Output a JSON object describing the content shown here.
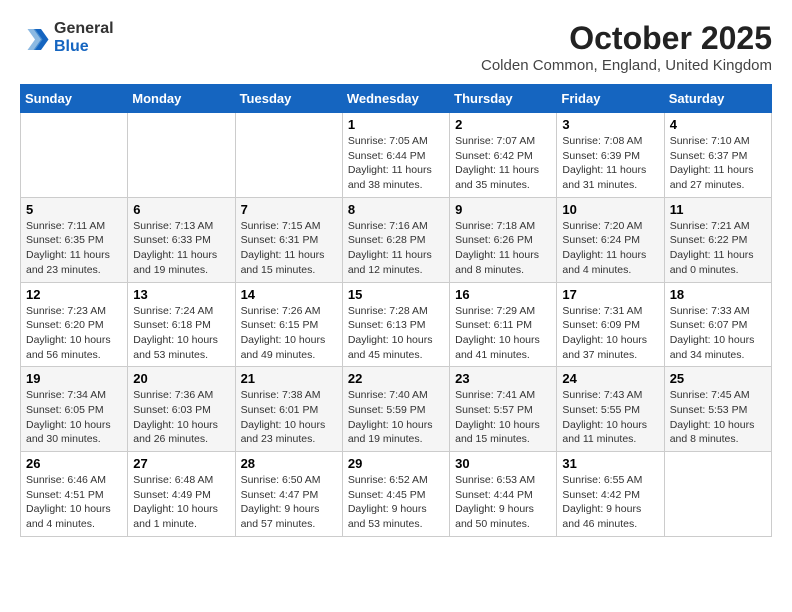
{
  "header": {
    "logo_general": "General",
    "logo_blue": "Blue",
    "month_title": "October 2025",
    "location": "Colden Common, England, United Kingdom"
  },
  "days_of_week": [
    "Sunday",
    "Monday",
    "Tuesday",
    "Wednesday",
    "Thursday",
    "Friday",
    "Saturday"
  ],
  "weeks": [
    [
      {
        "day": "",
        "detail": ""
      },
      {
        "day": "",
        "detail": ""
      },
      {
        "day": "",
        "detail": ""
      },
      {
        "day": "1",
        "detail": "Sunrise: 7:05 AM\nSunset: 6:44 PM\nDaylight: 11 hours\nand 38 minutes."
      },
      {
        "day": "2",
        "detail": "Sunrise: 7:07 AM\nSunset: 6:42 PM\nDaylight: 11 hours\nand 35 minutes."
      },
      {
        "day": "3",
        "detail": "Sunrise: 7:08 AM\nSunset: 6:39 PM\nDaylight: 11 hours\nand 31 minutes."
      },
      {
        "day": "4",
        "detail": "Sunrise: 7:10 AM\nSunset: 6:37 PM\nDaylight: 11 hours\nand 27 minutes."
      }
    ],
    [
      {
        "day": "5",
        "detail": "Sunrise: 7:11 AM\nSunset: 6:35 PM\nDaylight: 11 hours\nand 23 minutes."
      },
      {
        "day": "6",
        "detail": "Sunrise: 7:13 AM\nSunset: 6:33 PM\nDaylight: 11 hours\nand 19 minutes."
      },
      {
        "day": "7",
        "detail": "Sunrise: 7:15 AM\nSunset: 6:31 PM\nDaylight: 11 hours\nand 15 minutes."
      },
      {
        "day": "8",
        "detail": "Sunrise: 7:16 AM\nSunset: 6:28 PM\nDaylight: 11 hours\nand 12 minutes."
      },
      {
        "day": "9",
        "detail": "Sunrise: 7:18 AM\nSunset: 6:26 PM\nDaylight: 11 hours\nand 8 minutes."
      },
      {
        "day": "10",
        "detail": "Sunrise: 7:20 AM\nSunset: 6:24 PM\nDaylight: 11 hours\nand 4 minutes."
      },
      {
        "day": "11",
        "detail": "Sunrise: 7:21 AM\nSunset: 6:22 PM\nDaylight: 11 hours\nand 0 minutes."
      }
    ],
    [
      {
        "day": "12",
        "detail": "Sunrise: 7:23 AM\nSunset: 6:20 PM\nDaylight: 10 hours\nand 56 minutes."
      },
      {
        "day": "13",
        "detail": "Sunrise: 7:24 AM\nSunset: 6:18 PM\nDaylight: 10 hours\nand 53 minutes."
      },
      {
        "day": "14",
        "detail": "Sunrise: 7:26 AM\nSunset: 6:15 PM\nDaylight: 10 hours\nand 49 minutes."
      },
      {
        "day": "15",
        "detail": "Sunrise: 7:28 AM\nSunset: 6:13 PM\nDaylight: 10 hours\nand 45 minutes."
      },
      {
        "day": "16",
        "detail": "Sunrise: 7:29 AM\nSunset: 6:11 PM\nDaylight: 10 hours\nand 41 minutes."
      },
      {
        "day": "17",
        "detail": "Sunrise: 7:31 AM\nSunset: 6:09 PM\nDaylight: 10 hours\nand 37 minutes."
      },
      {
        "day": "18",
        "detail": "Sunrise: 7:33 AM\nSunset: 6:07 PM\nDaylight: 10 hours\nand 34 minutes."
      }
    ],
    [
      {
        "day": "19",
        "detail": "Sunrise: 7:34 AM\nSunset: 6:05 PM\nDaylight: 10 hours\nand 30 minutes."
      },
      {
        "day": "20",
        "detail": "Sunrise: 7:36 AM\nSunset: 6:03 PM\nDaylight: 10 hours\nand 26 minutes."
      },
      {
        "day": "21",
        "detail": "Sunrise: 7:38 AM\nSunset: 6:01 PM\nDaylight: 10 hours\nand 23 minutes."
      },
      {
        "day": "22",
        "detail": "Sunrise: 7:40 AM\nSunset: 5:59 PM\nDaylight: 10 hours\nand 19 minutes."
      },
      {
        "day": "23",
        "detail": "Sunrise: 7:41 AM\nSunset: 5:57 PM\nDaylight: 10 hours\nand 15 minutes."
      },
      {
        "day": "24",
        "detail": "Sunrise: 7:43 AM\nSunset: 5:55 PM\nDaylight: 10 hours\nand 11 minutes."
      },
      {
        "day": "25",
        "detail": "Sunrise: 7:45 AM\nSunset: 5:53 PM\nDaylight: 10 hours\nand 8 minutes."
      }
    ],
    [
      {
        "day": "26",
        "detail": "Sunrise: 6:46 AM\nSunset: 4:51 PM\nDaylight: 10 hours\nand 4 minutes."
      },
      {
        "day": "27",
        "detail": "Sunrise: 6:48 AM\nSunset: 4:49 PM\nDaylight: 10 hours\nand 1 minute."
      },
      {
        "day": "28",
        "detail": "Sunrise: 6:50 AM\nSunset: 4:47 PM\nDaylight: 9 hours\nand 57 minutes."
      },
      {
        "day": "29",
        "detail": "Sunrise: 6:52 AM\nSunset: 4:45 PM\nDaylight: 9 hours\nand 53 minutes."
      },
      {
        "day": "30",
        "detail": "Sunrise: 6:53 AM\nSunset: 4:44 PM\nDaylight: 9 hours\nand 50 minutes."
      },
      {
        "day": "31",
        "detail": "Sunrise: 6:55 AM\nSunset: 4:42 PM\nDaylight: 9 hours\nand 46 minutes."
      },
      {
        "day": "",
        "detail": ""
      }
    ]
  ]
}
